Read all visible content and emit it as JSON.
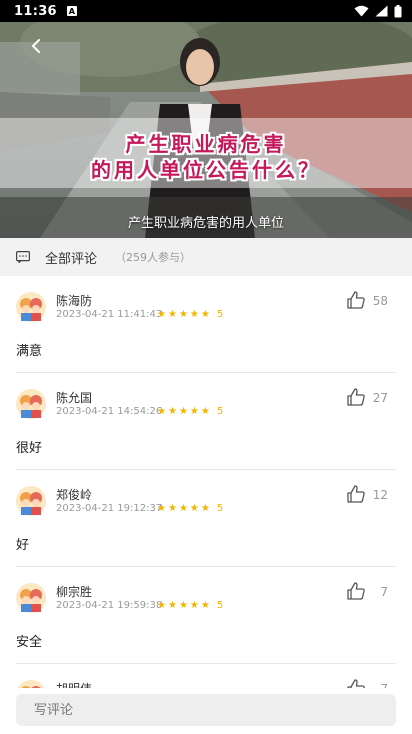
{
  "status_bar": {
    "time": "11:36",
    "notification_icon": "A"
  },
  "video": {
    "title_line1": "产生职业病危害",
    "title_line2": "的用人单位公告什么？",
    "subtitle": "产生职业病危害的用人单位",
    "back_icon": "chevron-left-icon"
  },
  "comments_header": {
    "label": "全部评论",
    "count": "（259人参与）"
  },
  "comments": [
    {
      "name": "陈海防",
      "time": "2023-04-21 11:41:43",
      "score": "5",
      "likes": "58",
      "text": "满意"
    },
    {
      "name": "陈允国",
      "time": "2023-04-21 14:54:26",
      "score": "5",
      "likes": "27",
      "text": "很好"
    },
    {
      "name": "郑俊岭",
      "time": "2023-04-21 19:12:37",
      "score": "5",
      "likes": "12",
      "text": "好"
    },
    {
      "name": "柳宗胜",
      "time": "2023-04-21 19:59:38",
      "score": "5",
      "likes": "7",
      "text": "安全"
    },
    {
      "name": "胡明伟",
      "time": "",
      "score": "",
      "likes": "7",
      "text": ""
    }
  ],
  "input": {
    "placeholder": "写评论"
  },
  "colors": {
    "title": "#c4195a",
    "star": "#f3b400",
    "header_bg": "#f2f2f2"
  }
}
